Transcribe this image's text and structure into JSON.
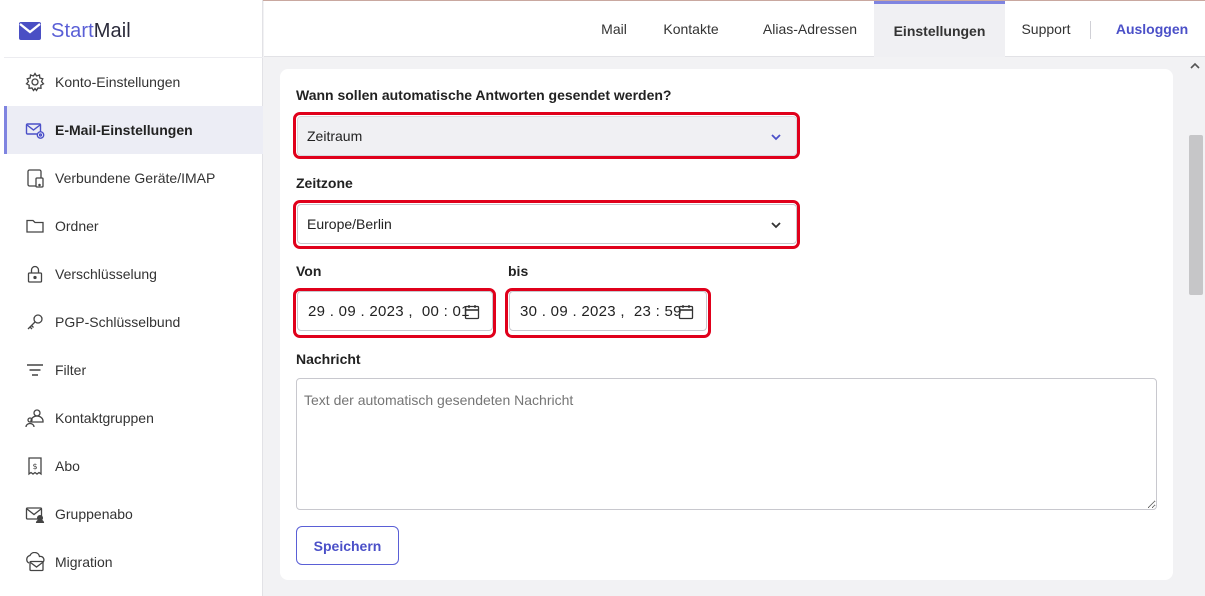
{
  "app": {
    "brand_start": "Start",
    "brand_mail": "Mail"
  },
  "header": {
    "tabs": [
      {
        "label": "Mail"
      },
      {
        "label": "Kontakte"
      },
      {
        "label": "Alias-Adressen"
      },
      {
        "label": "Einstellungen",
        "active": true
      },
      {
        "label": "Support"
      }
    ],
    "logout_label": "Ausloggen"
  },
  "sidebar": {
    "items": [
      {
        "label": "Konto-Einstellungen",
        "icon": "gear-icon"
      },
      {
        "label": "E-Mail-Einstellungen",
        "icon": "mail-settings-icon",
        "active": true
      },
      {
        "label": "Verbundene Geräte/IMAP",
        "icon": "devices-icon"
      },
      {
        "label": "Ordner",
        "icon": "folder-icon"
      },
      {
        "label": "Verschlüsselung",
        "icon": "lock-icon"
      },
      {
        "label": "PGP-Schlüsselbund",
        "icon": "key-icon"
      },
      {
        "label": "Filter",
        "icon": "filter-icon"
      },
      {
        "label": "Kontaktgruppen",
        "icon": "contact-groups-icon"
      },
      {
        "label": "Abo",
        "icon": "receipt-icon"
      },
      {
        "label": "Gruppenabo",
        "icon": "group-mail-icon"
      },
      {
        "label": "Migration",
        "icon": "cloud-mail-icon"
      }
    ]
  },
  "form": {
    "when_label": "Wann sollen automatische Antworten gesendet werden?",
    "when_value": "Zeitraum",
    "timezone_label": "Zeitzone",
    "timezone_value": "Europe/Berlin",
    "from_label": "Von",
    "from_value": "29 . 09 . 2023 ,  00 : 01",
    "to_label": "bis",
    "to_value": "30 . 09 . 2023 ,  23 : 59",
    "message_label": "Nachricht",
    "message_placeholder": "Text der automatisch gesendeten Nachricht",
    "message_value": "",
    "save_label": "Speichern"
  },
  "colors": {
    "accent": "#5a5fd6",
    "highlight": "#e0001b"
  }
}
